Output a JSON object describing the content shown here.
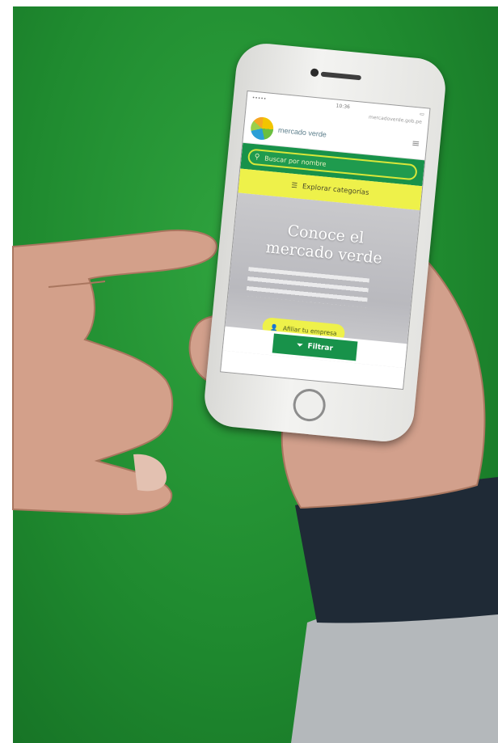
{
  "scene": {
    "description_free_note": "",
    "colors": {
      "background_green": "#1f8a2f",
      "skin": "#d8a58a",
      "sleeve_dark": "#1f2a36",
      "sweater_grey": "#b8bcbf",
      "phone_body": "#ebebe8",
      "brand_green": "#18924a",
      "brand_yellow": "#eef14a"
    }
  },
  "phone_screen": {
    "status_time": "10:36",
    "url": "mercadoverde.gob.pe",
    "logo": {
      "icon": "leaf-circle-icon",
      "text": "mercado verde"
    },
    "menu_icon": "hamburger-icon",
    "search": {
      "icon": "search-icon",
      "placeholder": "Buscar por nombre"
    },
    "categories_button": {
      "icon": "list-icon",
      "label": "Explorar categorías"
    },
    "hero": {
      "title_line1": "Conoce el",
      "title_line2": "mercado verde"
    },
    "register_button": {
      "icon": "user-plus-icon",
      "label": "Afiliar tu empresa"
    },
    "filter_button": {
      "icon": "filter-icon",
      "label": "Filtrar"
    }
  }
}
